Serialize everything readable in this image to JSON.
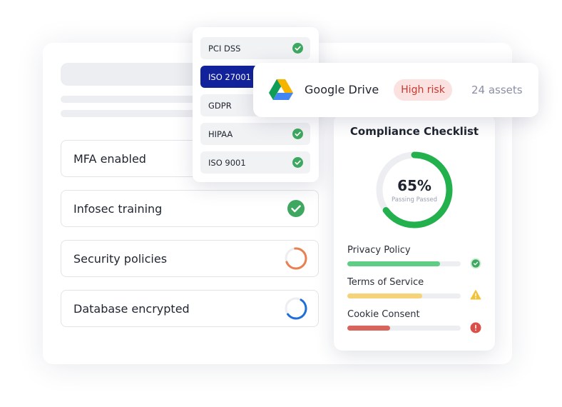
{
  "tasks": [
    {
      "label": "MFA enabled",
      "status": "none"
    },
    {
      "label": "Infosec training",
      "status": "done"
    },
    {
      "label": "Security policies",
      "status": "in-progress"
    },
    {
      "label": "Database encrypted",
      "status": "in-progress"
    }
  ],
  "frameworks": [
    {
      "label": "PCI DSS",
      "checked": true,
      "selected": false
    },
    {
      "label": "ISO 27001",
      "checked": false,
      "selected": true
    },
    {
      "label": "GDPR",
      "checked": false,
      "selected": false
    },
    {
      "label": "HIPAA",
      "checked": true,
      "selected": false
    },
    {
      "label": "ISO 9001",
      "checked": true,
      "selected": false
    }
  ],
  "integration": {
    "name": "Google Drive",
    "risk": "High risk",
    "assets": "24 assets"
  },
  "checklist": {
    "title": "Compliance Checklist",
    "percent_label": "65%",
    "percent": 0.65,
    "subtitle": "Passing Passed",
    "policies": [
      {
        "label": "Privacy Policy",
        "progress": 0.82,
        "status": "ok",
        "color": "#5fcd83"
      },
      {
        "label": "Terms of Service",
        "progress": 0.66,
        "status": "warning",
        "color": "#f5d37a"
      },
      {
        "label": "Cookie Consent",
        "progress": 0.38,
        "status": "error",
        "color": "#d9645c"
      }
    ]
  },
  "colors": {
    "success": "#3fa860",
    "donut": "#22b14c",
    "warning": "#f0c43a",
    "error": "#d94f4a",
    "selected": "#12229a"
  }
}
